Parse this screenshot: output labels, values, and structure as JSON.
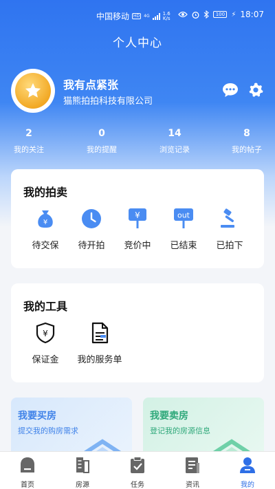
{
  "status_bar": {
    "carrier": "中国移动",
    "hd_badge": "HD",
    "network": "4G",
    "speed_value": "1.6",
    "speed_unit": "K/s",
    "battery": "100",
    "time": "18:07"
  },
  "header": {
    "title": "个人中心"
  },
  "profile": {
    "name": "我有点紧张",
    "company": "猫熊拍拍科技有限公司",
    "message_icon": "chat-bubble-icon",
    "settings_icon": "gear-icon"
  },
  "stats": [
    {
      "value": "2",
      "label": "我的关注"
    },
    {
      "value": "0",
      "label": "我的提醒"
    },
    {
      "value": "14",
      "label": "浏览记录"
    },
    {
      "value": "8",
      "label": "我的帖子"
    }
  ],
  "auction": {
    "title": "我的拍卖",
    "items": [
      {
        "label": "待交保",
        "icon": "money-bag-icon"
      },
      {
        "label": "待开拍",
        "icon": "clock-icon"
      },
      {
        "label": "竞价中",
        "icon": "yen-sign-icon"
      },
      {
        "label": "已结束",
        "icon": "out-sign-icon",
        "icon_text": "out"
      },
      {
        "label": "已拍下",
        "icon": "gavel-icon"
      }
    ]
  },
  "tools": {
    "title": "我的工具",
    "items": [
      {
        "label": "保证金",
        "icon": "deposit-shield-icon"
      },
      {
        "label": "我的服务单",
        "icon": "document-icon"
      }
    ]
  },
  "promos": [
    {
      "title": "我要买房",
      "subtitle": "提交我的购房需求"
    },
    {
      "title": "我要卖房",
      "subtitle": "登记我的房源信息"
    }
  ],
  "tabbar": {
    "items": [
      {
        "label": "首页",
        "icon": "home-icon"
      },
      {
        "label": "房源",
        "icon": "buildings-icon"
      },
      {
        "label": "任务",
        "icon": "clipboard-check-icon"
      },
      {
        "label": "资讯",
        "icon": "news-icon"
      },
      {
        "label": "我的",
        "icon": "person-icon",
        "active": true
      }
    ]
  },
  "colors": {
    "primary": "#2e6fe6",
    "icon_blue": "#4a8cf2",
    "avatar_gold": "#f2a925",
    "buy_accent": "#3f82e8",
    "sell_accent": "#2fa87a"
  }
}
